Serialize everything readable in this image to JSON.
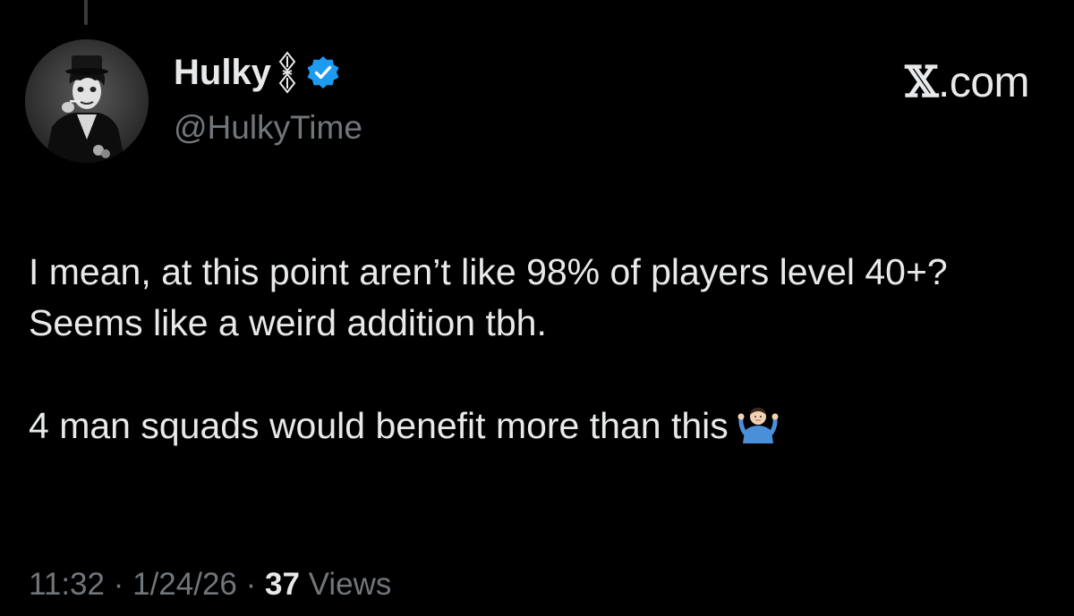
{
  "author": {
    "display_name": "Hulky",
    "handle": "@HulkyTime",
    "avatar_icon": "avatar-photo",
    "verified_color": "#1d9bf0"
  },
  "brand": {
    "label_x": "𝕏",
    "label_domain": ".com"
  },
  "tweet": {
    "paragraph_1": "I mean, at this point aren’t like 98% of players level 40+? Seems like a weird addition tbh.",
    "paragraph_2": "4 man squads would benefit more than this",
    "emoji_icon": "shrug-emoji-icon"
  },
  "meta": {
    "time": "11:32",
    "separator_1": " · ",
    "date": "1/24/26",
    "separator_2": " · ",
    "views_count": "37",
    "views_label": " Views"
  },
  "colors": {
    "background": "#000000",
    "primary_text": "#e7e9ea",
    "secondary_text": "#71767b"
  }
}
